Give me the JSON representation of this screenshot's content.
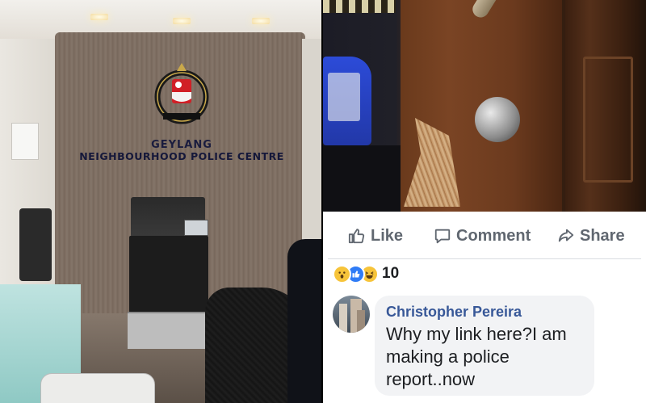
{
  "photo_left": {
    "sign_line1": "GEYLANG",
    "sign_line2": "NEIGHBOURHOOD POLICE CENTRE",
    "crest_text_top": "POLIS",
    "crest_text_bottom": "REPUBLIK SINGAPURA"
  },
  "post": {
    "actions": {
      "like": "Like",
      "comment": "Comment",
      "share": "Share"
    },
    "reactions": {
      "icons": [
        "wow-icon",
        "like-icon",
        "haha-icon"
      ],
      "count": "10"
    },
    "comment": {
      "author": "Christopher Pereira",
      "text": "Why my link here?I am making a police report..now"
    }
  },
  "colors": {
    "fb_action_gray": "#606770",
    "fb_name_blue": "#385898",
    "bubble_bg": "#f2f3f5",
    "like_blue": "#2f7cf6"
  }
}
